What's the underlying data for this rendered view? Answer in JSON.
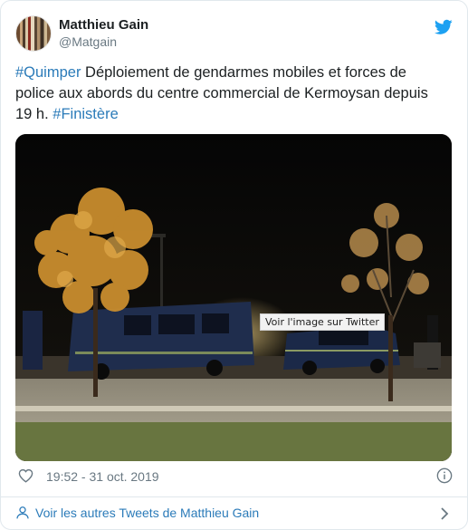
{
  "author": {
    "name": "Matthieu Gain",
    "handle": "@Matgain"
  },
  "tweet": {
    "hashtag_1": "#Quimper",
    "text_1": " Déploiement de gendarmes mobiles et forces de police aux abords du centre commercial de Kermoysan depuis 19 h. ",
    "hashtag_2": "#Finistère"
  },
  "media": {
    "overlay_label": "Voir l'image sur Twitter"
  },
  "meta": {
    "timestamp": "19:52 - 31 oct. 2019"
  },
  "footer": {
    "link_label": "Voir les autres Tweets de Matthieu Gain"
  },
  "icons": {
    "brand": "twitter-bird-icon",
    "like": "heart-icon",
    "info": "info-icon",
    "profile": "person-icon",
    "chevron": "chevron-right-icon"
  },
  "colors": {
    "link": "#2b7bb9",
    "brand": "#1da1f2",
    "secondary_text": "#697882",
    "border": "#e1e8ed"
  }
}
